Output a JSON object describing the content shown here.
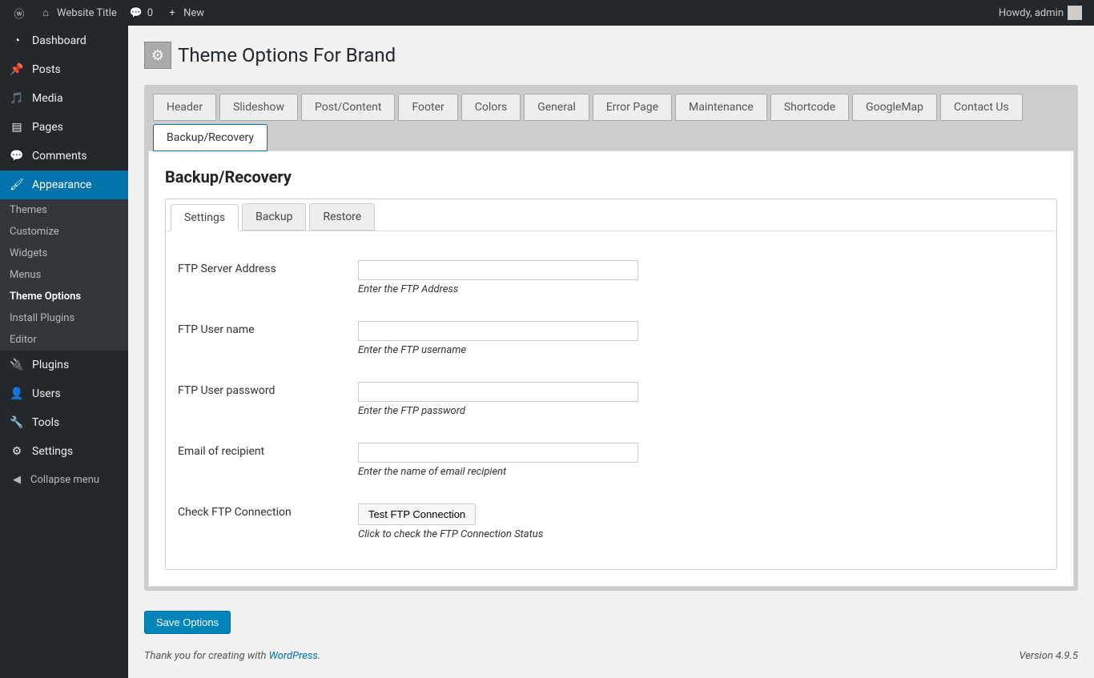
{
  "adminbar": {
    "site": "Website Title",
    "comments": "0",
    "new": "New",
    "greeting": "Howdy, admin"
  },
  "sidebar": {
    "dashboard": "Dashboard",
    "posts": "Posts",
    "media": "Media",
    "pages": "Pages",
    "comments": "Comments",
    "appearance": "Appearance",
    "submenu": {
      "themes": "Themes",
      "customize": "Customize",
      "widgets": "Widgets",
      "menus": "Menus",
      "theme_options": "Theme Options",
      "install_plugins": "Install Plugins",
      "editor": "Editor"
    },
    "plugins": "Plugins",
    "users": "Users",
    "tools": "Tools",
    "settings": "Settings",
    "collapse": "Collapse menu"
  },
  "page": {
    "title": "Theme Options For Brand"
  },
  "tabs": {
    "header": "Header",
    "slideshow": "Slideshow",
    "post": "Post/Content",
    "footer": "Footer",
    "colors": "Colors",
    "general": "General",
    "error": "Error Page",
    "maintenance": "Maintenance",
    "shortcode": "Shortcode",
    "googlemap": "GoogleMap",
    "contact": "Contact Us",
    "backup": "Backup/Recovery"
  },
  "section": {
    "title": "Backup/Recovery",
    "subtabs": {
      "settings": "Settings",
      "backup": "Backup",
      "restore": "Restore"
    }
  },
  "form": {
    "server": {
      "label": "FTP Server Address",
      "hint": "Enter the FTP Address"
    },
    "user": {
      "label": "FTP User name",
      "hint": "Enter the FTP username"
    },
    "pass": {
      "label": "FTP User password",
      "hint": "Enter the FTP password"
    },
    "email": {
      "label": "Email of recipient",
      "hint": "Enter the name of email recipient"
    },
    "check": {
      "label": "Check FTP Connection",
      "button": "Test FTP Connection",
      "hint": "Click to check the FTP Connection Status"
    }
  },
  "buttons": {
    "save": "Save Options"
  },
  "footer": {
    "thanks_prefix": "Thank you for creating with ",
    "wp": "WordPress",
    "version": "Version 4.9.5"
  }
}
